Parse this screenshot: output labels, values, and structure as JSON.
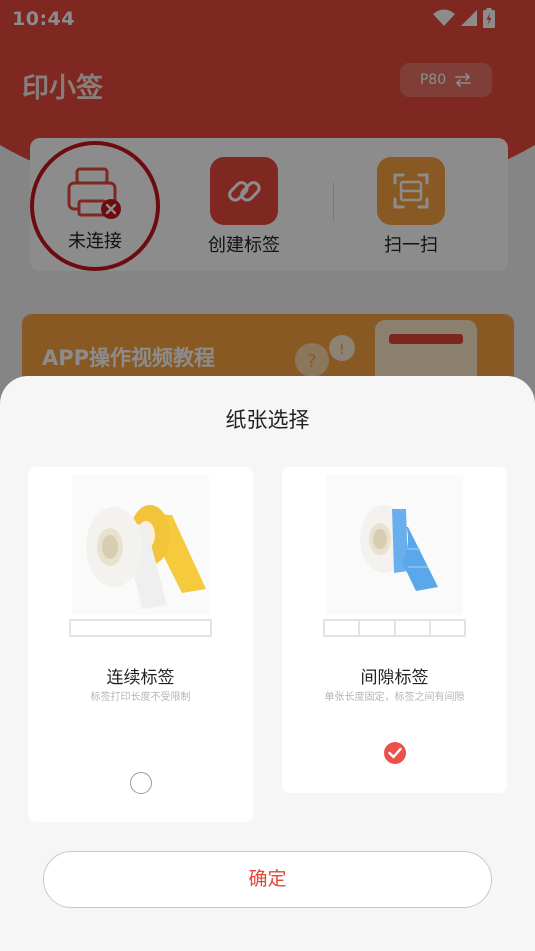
{
  "status": {
    "time": "10:44"
  },
  "app": {
    "title": "印小签",
    "printer_model": "P80"
  },
  "actions": {
    "connect_label": "未连接",
    "create_label": "创建标签",
    "scan_label": "扫一扫"
  },
  "tutorial": {
    "label": "APP操作视频教程"
  },
  "sheet": {
    "title": "纸张选择",
    "options": [
      {
        "name": "连续标签",
        "desc": "标签打印长度不受限制",
        "selected": false
      },
      {
        "name": "间隙标签",
        "desc": "单张长度固定，标签之间有间隙",
        "selected": true
      }
    ],
    "confirm_label": "确定"
  },
  "colors": {
    "brand_red": "#e5493c",
    "accent_red": "#ec5149",
    "orange": "#f7a23f",
    "blue_roll": "#5aa7ec",
    "yellow_roll": "#f5cb3d"
  },
  "icons": [
    "wifi-icon",
    "signal-icon",
    "battery-icon",
    "swap-icon",
    "printer-icon",
    "link-icon",
    "scan-icon",
    "check-icon"
  ]
}
